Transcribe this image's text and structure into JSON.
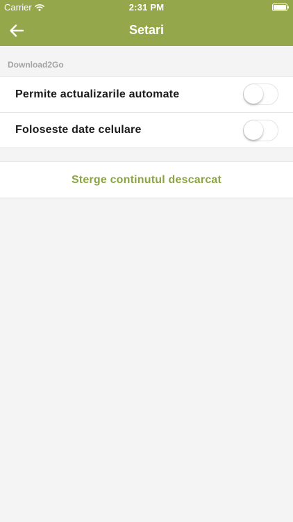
{
  "status_bar": {
    "carrier": "Carrier",
    "time": "2:31 PM",
    "icons": [
      "wifi-icon",
      "battery-icon"
    ]
  },
  "nav": {
    "title": "Setari",
    "back_icon": "arrow-left-icon"
  },
  "section": {
    "header": "Download2Go",
    "rows": [
      {
        "label": "Permite actualizarile automate",
        "enabled": false
      },
      {
        "label": "Foloseste date celulare",
        "enabled": false
      }
    ]
  },
  "action": {
    "label": "Sterge continutul descarcat"
  },
  "colors": {
    "header_bg": "#94a84b",
    "accent_text": "#8ba444",
    "background": "#f4f4f4"
  }
}
